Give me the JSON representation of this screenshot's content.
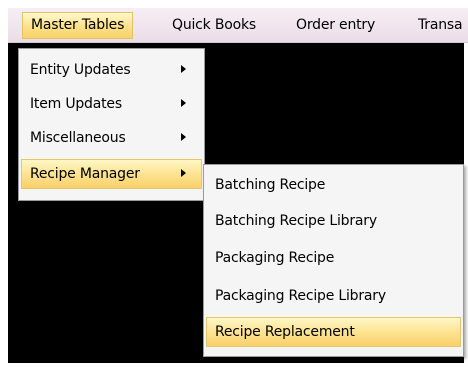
{
  "menubar": {
    "items": [
      {
        "label": "Master Tables"
      },
      {
        "label": "Quick Books"
      },
      {
        "label": "Order entry"
      },
      {
        "label": "Transa"
      }
    ]
  },
  "master_tables_menu": {
    "items": [
      {
        "label": "Entity Updates",
        "has_submenu": true
      },
      {
        "label": "Item Updates",
        "has_submenu": true
      },
      {
        "label": "Miscellaneous",
        "has_submenu": true
      },
      {
        "label": "Recipe Manager",
        "has_submenu": true
      }
    ]
  },
  "recipe_manager_menu": {
    "items": [
      {
        "label": "Batching Recipe"
      },
      {
        "label": "Batching Recipe Library"
      },
      {
        "label": "Packaging Recipe"
      },
      {
        "label": "Packaging Recipe Library"
      },
      {
        "label": "Recipe Replacement"
      }
    ]
  },
  "colors": {
    "highlight": "#fde18a",
    "menubar": "#ebdde8",
    "menu_background": "#f5f5f5",
    "workspace": "#000000"
  }
}
